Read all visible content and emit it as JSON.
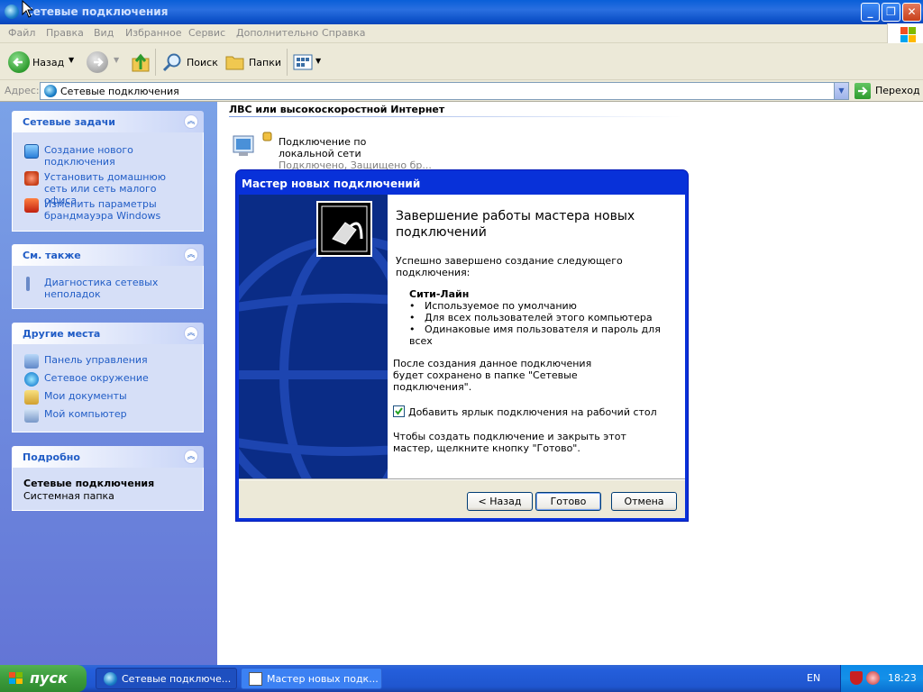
{
  "window": {
    "title": "Сетевые подключения"
  },
  "menu": [
    "Файл",
    "Правка",
    "Вид",
    "Избранное",
    "Сервис",
    "Дополнительно",
    "Справка"
  ],
  "toolbar": {
    "back": "Назад",
    "search": "Поиск",
    "folders": "Папки"
  },
  "address": {
    "label": "Адрес:",
    "value": "Сетевые подключения",
    "go": "Переход"
  },
  "left_panels": {
    "network_tasks": {
      "title": "Сетевые задачи",
      "items": [
        "Создание нового подключения",
        "Установить домашнюю сеть или сеть малого офиса",
        "Изменить параметры брандмауэра Windows"
      ]
    },
    "see_also": {
      "title": "См. также",
      "items": [
        "Диагностика сетевых неполадок"
      ]
    },
    "other_places": {
      "title": "Другие места",
      "items": [
        "Панель управления",
        "Сетевое окружение",
        "Мои документы",
        "Мой компьютер"
      ]
    },
    "details": {
      "title": "Подробно",
      "name": "Сетевые подключения",
      "type": "Системная папка"
    }
  },
  "content": {
    "group_header": "ЛВС или высокоскоростной Интернет",
    "connection": {
      "name": "Подключение по локальной сети",
      "status": "Подключено, Защищено бр..."
    }
  },
  "wizard": {
    "title": "Мастер новых подключений",
    "heading": "Завершение работы мастера новых подключений",
    "intro": "Успешно завершено создание следующего подключения:",
    "conn_name": "Сити-Лайн",
    "bullets": [
      "Используемое по умолчанию",
      "Для всех пользователей этого компьютера",
      "Одинаковые имя пользователя и пароль для всех"
    ],
    "saved_note": "После создания данное подключения будет сохранено в папке \"Сетевые подключения\".",
    "checkbox_label": "Добавить ярлык подключения на рабочий стол",
    "checkbox_checked": true,
    "finish_note": "Чтобы создать подключение и закрыть этот мастер, щелкните кнопку \"Готово\".",
    "buttons": {
      "back": "< Назад",
      "finish": "Готово",
      "cancel": "Отмена"
    }
  },
  "taskbar": {
    "start": "пуск",
    "tasks": [
      "Сетевые подключе...",
      "Мастер новых подк..."
    ],
    "lang": "EN",
    "time": "18:23"
  }
}
